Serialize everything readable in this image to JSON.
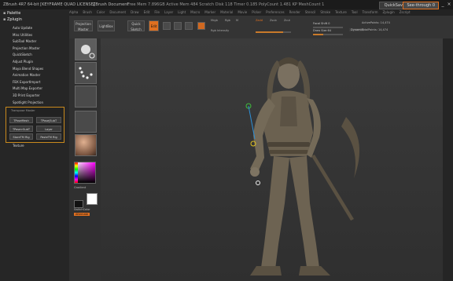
{
  "titlebar": {
    "app_title": "ZBrush 4R7 64-bit [KEYFRAME QUAD LICENSE]",
    "doc_label": "ZBrush Document",
    "stats": "Free Mem 7.896GB  Active Mem 484  Scratch Disk 118  Timer 0.185  PolyCount 1.481 KP  MeshCount 1",
    "quicksave_label": "QuickSave",
    "see_through_label": "See-through 0",
    "minimize": "_",
    "close": "×"
  },
  "menubar": [
    "Alpha",
    "Brush",
    "Color",
    "Document",
    "Draw",
    "Edit",
    "File",
    "Layer",
    "Light",
    "Macro",
    "Marker",
    "Material",
    "Movie",
    "Picker",
    "Preferences",
    "Render",
    "Stencil",
    "Stroke",
    "Texture",
    "Tool",
    "Transform",
    "Zplugin",
    "Zscript"
  ],
  "lefttray": {
    "header1": "Palette",
    "header2": "Zplugin",
    "items": [
      "Auto Update",
      "Misc Utilities",
      "SubTool Master",
      "Projection Master",
      "QuickSketch",
      "Adjust Plugin",
      "Maya Blend Shapes",
      "Animation Master",
      "FBX ExportImport",
      "Multi Map Exporter",
      "3D Print Exporter",
      "Spotlight Projection"
    ],
    "subpanel": {
      "title": "Transpose Master",
      "buttons": [
        "TPoseMesh",
        "TPose|SubT",
        "TPose>SubT",
        "Layer",
        "StoreTM Rig",
        "PasteTM Rig"
      ]
    },
    "bottom_item": "Texture"
  },
  "shelf": {
    "projection_label": "Projection Master",
    "lightbox_label": "LightBox",
    "quicksketch_label": "Quick Sketch",
    "edit_label": "Edit",
    "draw_label": "Draw",
    "move_label": "Move",
    "scale_label": "Scale",
    "rotate_label": "Rotate",
    "mrgb_label": "Mrgb",
    "rgb_label": "Rgb",
    "m_label": "M",
    "rgb_intensity_label": "Rgb Intensity",
    "zadd_label": "Zadd",
    "zsub_label": "Zsub",
    "zcut_label": "Zcut",
    "focal_label": "Focal Shift 0",
    "draw_size_label": "Draw Size 64",
    "z_intensity_label": "Z Intensity 25",
    "active_points": "ActivePoints: 14,474",
    "total_points": "TotalPoints: 14,474",
    "dynamic_label": "Dynamic",
    "zadd_value": 0.78,
    "zi_value": 0.35
  },
  "tools": {
    "gradient_label": "Gradient",
    "switch_color_label": "SwitchColor",
    "alternate_label": "Alternate"
  },
  "colors": {
    "accent": "#e07020",
    "subpanel_border": "#c98a1d",
    "panel": "#262626",
    "canvas_top": "#3b3b3b",
    "model": "#6e6453"
  }
}
